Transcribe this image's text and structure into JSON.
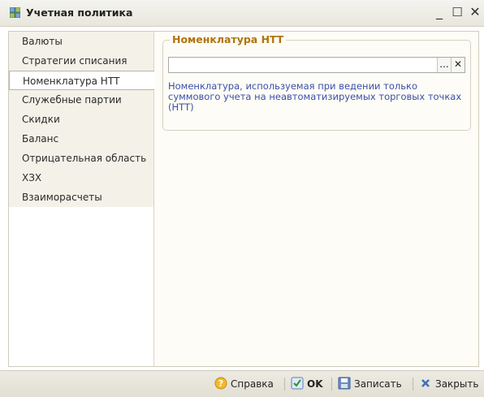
{
  "window": {
    "title": "Учетная политика",
    "minimize_label": "_",
    "maximize_label": "☐",
    "close_label": "✕"
  },
  "sidebar": {
    "items": [
      {
        "label": "Валюты"
      },
      {
        "label": "Стратегии списания"
      },
      {
        "label": "Номенклатура НТТ",
        "active": true
      },
      {
        "label": "Служебные партии"
      },
      {
        "label": "Скидки"
      },
      {
        "label": "Баланс"
      },
      {
        "label": "Отрицательная область"
      },
      {
        "label": "ХЗХ"
      },
      {
        "label": "Взаиморасчеты"
      }
    ]
  },
  "content": {
    "group_title": "Номенклатура НТТ",
    "field_value": "",
    "select_button": "...",
    "clear_button": "✕",
    "description_lines": [
      "Номенклатура, используемая при ведении только",
      "суммового учета на неавтоматизируемых торговых точках",
      "(НТТ)"
    ]
  },
  "footer": {
    "help_label": "Справка",
    "ok_label": "OK",
    "save_label": "Записать",
    "close_label": "Закрыть"
  },
  "colors": {
    "group_title": "#b0750a",
    "description": "#3b4fa8",
    "sidebar_bg": "#f4f2e8"
  }
}
